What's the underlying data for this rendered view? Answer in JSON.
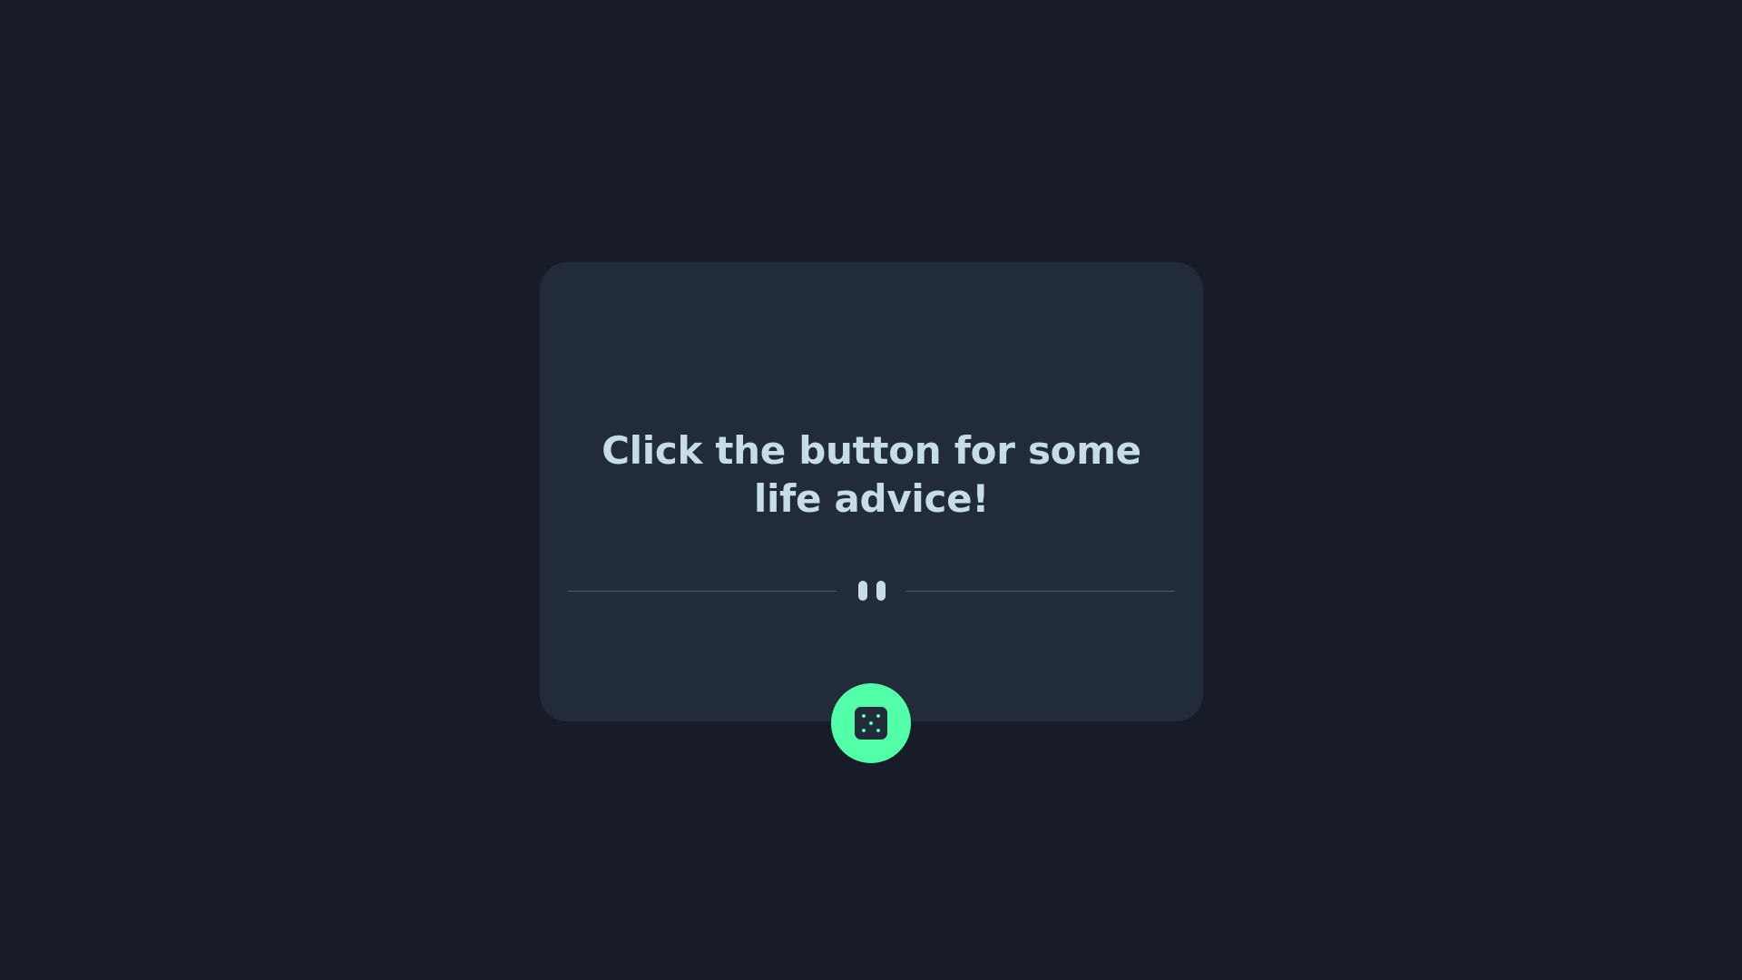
{
  "advice": {
    "text": "Click the button for some life advice!"
  },
  "divider": {
    "icon": "pause-icon"
  },
  "roll_button": {
    "icon": "dice-icon"
  },
  "colors": {
    "background": "#171c28",
    "card": "#222b39",
    "text": "#c6dde6",
    "accent": "#52ffa8",
    "divider_line": "#4f5d73"
  }
}
